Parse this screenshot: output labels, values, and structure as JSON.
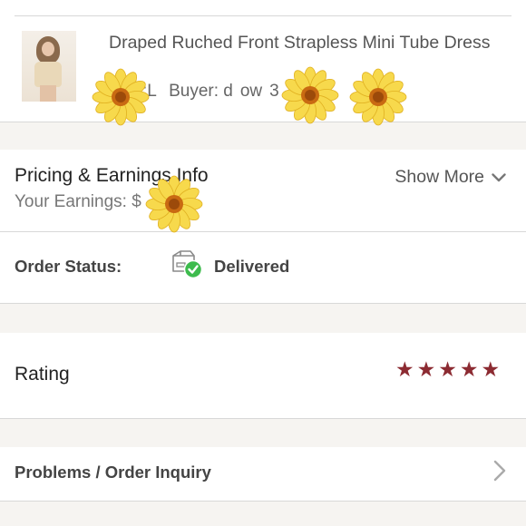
{
  "product": {
    "title": "Draped Ruched Front Strapless Mini Tube Dress",
    "size_label": "Size:L",
    "buyer_label": "Buyer: d",
    "buyer_tail": "ow",
    "buyer_end": "3"
  },
  "pricing": {
    "title": "Pricing & Earnings Info",
    "earnings_label": "Your Earnings: $",
    "show_more_label": "Show More"
  },
  "order_status": {
    "label": "Order Status:",
    "value": "Delivered",
    "icon": "box-check-icon"
  },
  "rating": {
    "label": "Rating",
    "stars": 5,
    "star_color": "#8c2b32"
  },
  "inquiry": {
    "label": "Problems / Order Inquiry"
  },
  "colors": {
    "divider": "#d8d8d8",
    "section_gap": "#f6f4f1",
    "check_green": "#3dbb4d",
    "flower_petal": "#f7d94c",
    "flower_center": "#c96a12"
  }
}
